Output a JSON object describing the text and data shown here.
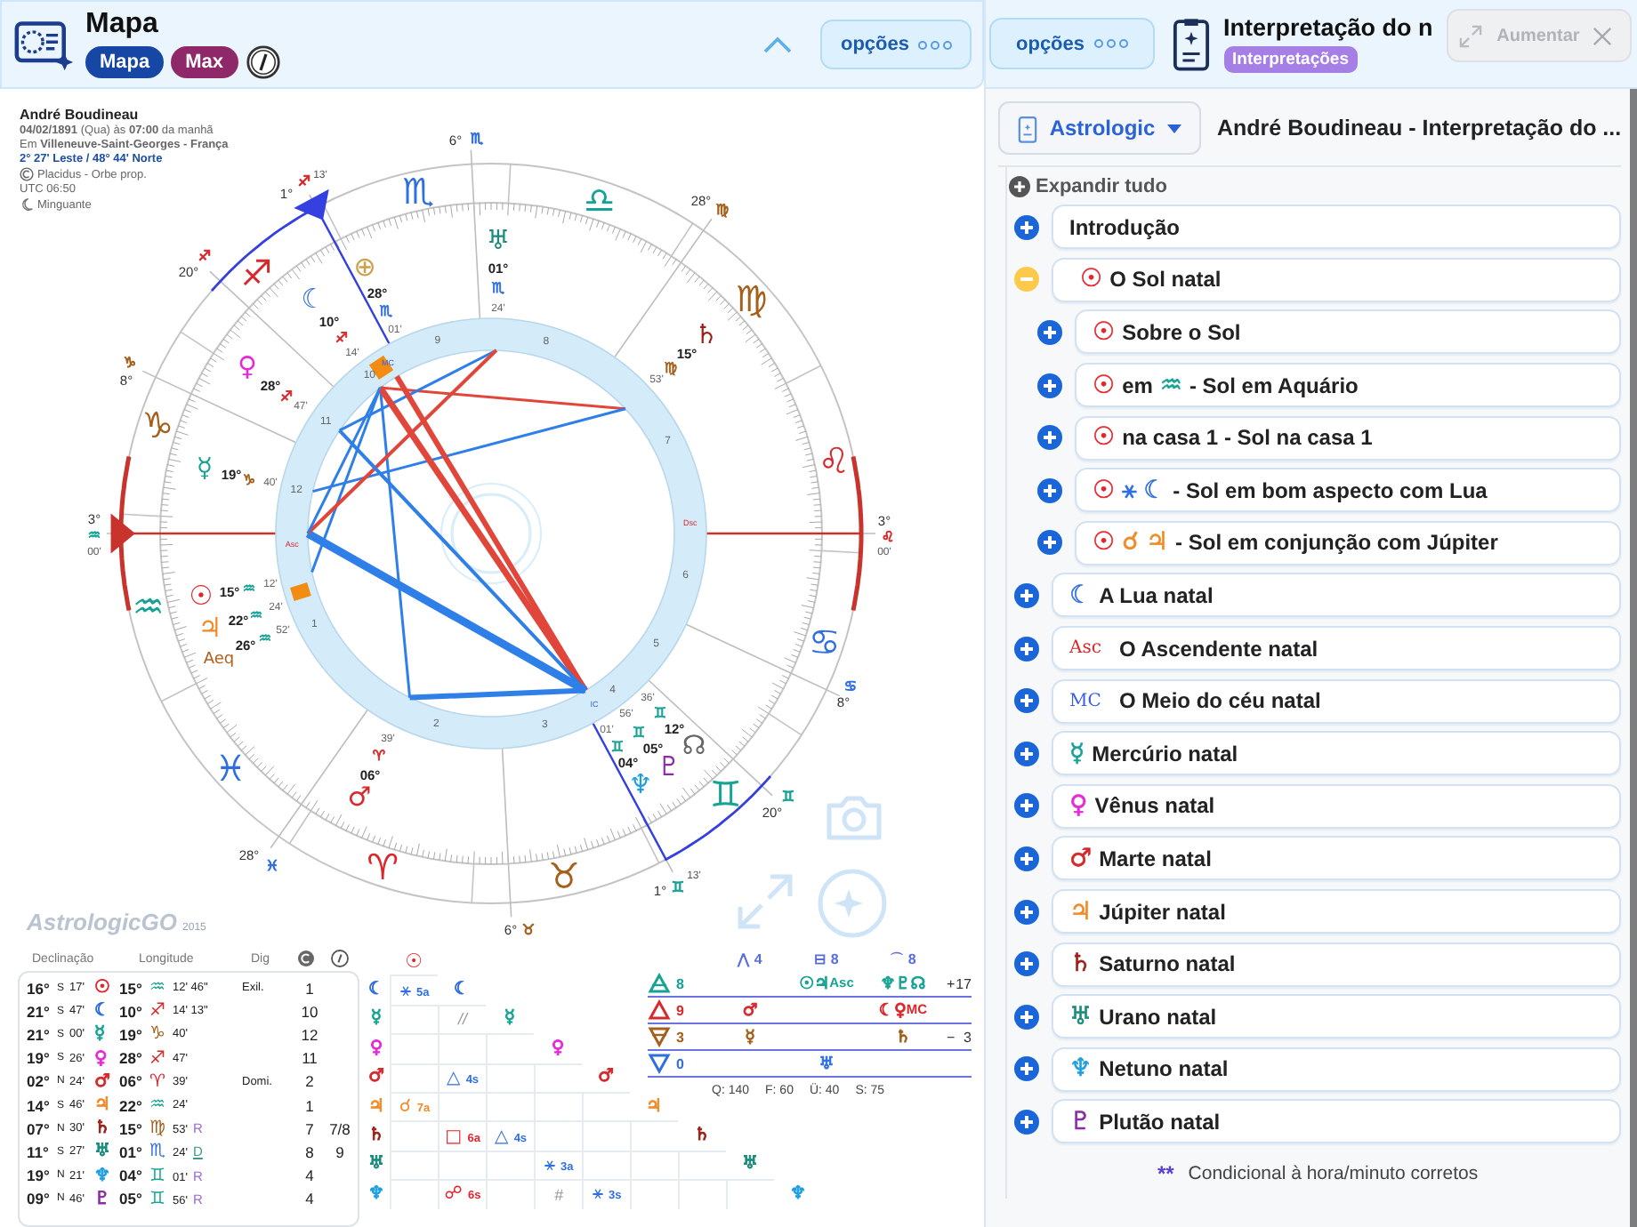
{
  "chart_panel": {
    "title": "Mapa",
    "tags": [
      {
        "label": "Mapa",
        "kind": "chart"
      },
      {
        "label": "Max",
        "kind": "max"
      }
    ],
    "options": "opções"
  },
  "person": {
    "name": "André Boudineau",
    "date_line": "**04/02/1891** (Qua) às **07:00** da manhã",
    "place_line": "Em **Villeneuve-Saint-Georges - França**",
    "coords": "2° 27' Leste / 48° 44' Norte",
    "system": "Placidus - Orbe prop.",
    "utc": "UTC 06:50",
    "phase": "Minguante"
  },
  "wheel": {
    "signs": [
      {
        "g": "♈",
        "color": "#d8282c"
      },
      {
        "g": "♉",
        "color": "#a5601c"
      },
      {
        "g": "♊",
        "color": "#16a394"
      },
      {
        "g": "♋",
        "color": "#2f6fe0"
      },
      {
        "g": "♌",
        "color": "#d8282c"
      },
      {
        "g": "♍",
        "color": "#a5601c"
      },
      {
        "g": "♎",
        "color": "#16a394"
      },
      {
        "g": "♏",
        "color": "#2f6fe0"
      },
      {
        "g": "♐",
        "color": "#d8282c"
      },
      {
        "g": "♑",
        "color": "#a5601c"
      },
      {
        "g": "♒",
        "color": "#16a394"
      },
      {
        "g": "♓",
        "color": "#2f6fe0"
      }
    ],
    "cusps": [
      {
        "deg": "6°",
        "sign": {
          "g": "♏",
          "color": "#2f6fe0"
        }
      },
      {
        "deg": "28°",
        "sign": {
          "g": "♍",
          "color": "#a5601c"
        }
      },
      {
        "deg": "3°",
        "sign": {
          "g": "♌",
          "color": "#d8282c"
        },
        "min": "00'"
      },
      {
        "deg": "8°",
        "sign": {
          "g": "♋",
          "color": "#2f6fe0"
        }
      },
      {
        "deg": "20°",
        "sign": {
          "g": "♊",
          "color": "#16a394"
        }
      },
      {
        "deg": "1°",
        "sign": {
          "g": "♊",
          "color": "#16a394"
        },
        "min": "13'"
      },
      {
        "deg": "6°",
        "sign": {
          "g": "♉",
          "color": "#a5601c"
        }
      },
      {
        "deg": "28°",
        "sign": {
          "g": "♓",
          "color": "#2f6fe0"
        }
      },
      {
        "deg": "3°",
        "sign": {
          "g": "♒",
          "color": "#16a394"
        },
        "min": "00'"
      },
      {
        "deg": "8°",
        "sign": {
          "g": "♑",
          "color": "#a5601c"
        }
      },
      {
        "deg": "20°",
        "sign": {
          "g": "♐",
          "color": "#d8282c"
        }
      },
      {
        "deg": "1°",
        "sign": {
          "g": "♐",
          "color": "#d8282c"
        },
        "min": "13'"
      }
    ],
    "houses": [
      "1",
      "2",
      "3",
      "4",
      "5",
      "6",
      "7",
      "8",
      "9",
      "10",
      "11",
      "12"
    ],
    "angles": [
      "Asc",
      "MC",
      "Dsc",
      "IC"
    ],
    "planets": [
      {
        "g": "☾",
        "color": "#2f6fe0",
        "deg": "10°",
        "sign": {
          "g": "♐",
          "color": "#d8282c"
        },
        "min": "14'"
      },
      {
        "g": "⊕",
        "color": "#c9a24a",
        "deg": "28°",
        "sign": {
          "g": "♏",
          "color": "#2f6fe0"
        },
        "min": "01'"
      },
      {
        "g": "♅",
        "color": "#1b8c7c",
        "deg": "01°",
        "sign": {
          "g": "♏",
          "color": "#2f6fe0"
        },
        "min": "24'"
      },
      {
        "g": "♄",
        "color": "#9a1f17",
        "deg": "15°",
        "sign": {
          "g": "♍",
          "color": "#a5601c"
        },
        "min": "53'"
      },
      {
        "g": "♀",
        "color": "#e62ad6",
        "deg": "28°",
        "sign": {
          "g": "♐",
          "color": "#d8282c"
        },
        "min": "47'"
      },
      {
        "g": "☿",
        "color": "#16a394",
        "deg": "19°",
        "sign": {
          "g": "♑",
          "color": "#a5601c"
        },
        "min": "40'"
      },
      {
        "g": "☉",
        "color": "#e5232b",
        "deg": "15°",
        "sign": {
          "g": "♒",
          "color": "#16a394"
        },
        "min": "12'"
      },
      {
        "g": "♃",
        "color": "#f08c28",
        "deg": "22°",
        "sign": {
          "g": "♒",
          "color": "#16a394"
        },
        "min": "24'"
      },
      {
        "g": "Aeq",
        "color": "#b0601a",
        "deg": "26°",
        "sign": {
          "g": "♒",
          "color": "#16a394"
        },
        "min": "52'"
      },
      {
        "g": "♂",
        "color": "#d8282c",
        "deg": "06°",
        "sign": {
          "g": "♈",
          "color": "#d8282c"
        },
        "min": "39'"
      },
      {
        "g": "♆",
        "color": "#1e9fe0",
        "deg": "04°",
        "sign": {
          "g": "♊",
          "color": "#16a394"
        },
        "min": "01'"
      },
      {
        "g": "♇",
        "color": "#8b2da3",
        "deg": "05°",
        "sign": {
          "g": "♊",
          "color": "#16a394"
        },
        "min": "56'"
      },
      {
        "g": "☊",
        "color": "#666666",
        "deg": "12°",
        "sign": {
          "g": "♊",
          "color": "#16a394"
        },
        "min": "36'"
      }
    ]
  },
  "logo": {
    "name": "AstrologicGO",
    "year": "2015"
  },
  "positions": {
    "headers": [
      "Declinação",
      "Longitude",
      "Dig"
    ],
    "rows": [
      {
        "decl_deg": "16°",
        "decl_dir": "S",
        "decl_min": "17'",
        "planet": {
          "g": "☉",
          "color": "#e5232b"
        },
        "lon_deg": "15°",
        "sign": {
          "g": "♒",
          "color": "#16a394"
        },
        "lon_min": "12' 46\"",
        "dig": "Exil.",
        "house": "1"
      },
      {
        "decl_deg": "21°",
        "decl_dir": "S",
        "decl_min": "47'",
        "planet": {
          "g": "☾",
          "color": "#2f6fe0"
        },
        "lon_deg": "10°",
        "sign": {
          "g": "♐",
          "color": "#d8282c"
        },
        "lon_min": "14' 13\"",
        "house": "10"
      },
      {
        "decl_deg": "21°",
        "decl_dir": "S",
        "decl_min": "00'",
        "planet": {
          "g": "☿",
          "color": "#16a394"
        },
        "lon_deg": "19°",
        "sign": {
          "g": "♑",
          "color": "#a5601c"
        },
        "lon_min": "40'",
        "house": "12"
      },
      {
        "decl_deg": "19°",
        "decl_dir": "S",
        "decl_min": "26'",
        "planet": {
          "g": "♀",
          "color": "#e62ad6"
        },
        "lon_deg": "28°",
        "sign": {
          "g": "♐",
          "color": "#d8282c"
        },
        "lon_min": "47'",
        "house": "11"
      },
      {
        "decl_deg": "02°",
        "decl_dir": "N",
        "decl_min": "24'",
        "planet": {
          "g": "♂",
          "color": "#d8282c"
        },
        "lon_deg": "06°",
        "sign": {
          "g": "♈",
          "color": "#d8282c"
        },
        "lon_min": "39'",
        "dig": "Domi.",
        "house": "2"
      },
      {
        "decl_deg": "14°",
        "decl_dir": "S",
        "decl_min": "46'",
        "planet": {
          "g": "♃",
          "color": "#f08c28"
        },
        "lon_deg": "22°",
        "sign": {
          "g": "♒",
          "color": "#16a394"
        },
        "lon_min": "24'",
        "house": "1"
      },
      {
        "decl_deg": "07°",
        "decl_dir": "N",
        "decl_min": "30'",
        "planet": {
          "g": "♄",
          "color": "#9a1f17"
        },
        "lon_deg": "15°",
        "sign": {
          "g": "♍",
          "color": "#a5601c"
        },
        "lon_min": "53'",
        "motion": "R",
        "house": "7",
        "house2": "7/8"
      },
      {
        "decl_deg": "11°",
        "decl_dir": "S",
        "decl_min": "27'",
        "planet": {
          "g": "♅",
          "color": "#1b8c7c"
        },
        "lon_deg": "01°",
        "sign": {
          "g": "♏",
          "color": "#2f6fe0"
        },
        "lon_min": "24'",
        "motion": "D",
        "house": "8",
        "house2": "9"
      },
      {
        "decl_deg": "19°",
        "decl_dir": "N",
        "decl_min": "21'",
        "planet": {
          "g": "♆",
          "color": "#1e9fe0"
        },
        "lon_deg": "04°",
        "sign": {
          "g": "♊",
          "color": "#16a394"
        },
        "lon_min": "01'",
        "motion": "R",
        "house": "4"
      },
      {
        "decl_deg": "09°",
        "decl_dir": "N",
        "decl_min": "46'",
        "planet": {
          "g": "♇",
          "color": "#8b2da3"
        },
        "lon_deg": "05°",
        "sign": {
          "g": "♊",
          "color": "#16a394"
        },
        "lon_min": "56'",
        "motion": "R",
        "house": "4"
      }
    ]
  },
  "aspect_grid": {
    "top": {
      "g": "☉",
      "color": "#e5232b"
    },
    "rows": [
      {
        "label": {
          "g": "☾",
          "color": "#2f6fe0"
        },
        "cells": [
          {
            "kind": "aspect",
            "g": "⚹",
            "orb": "5a",
            "color": "#2f6fe0"
          }
        ],
        "diag": {
          "g": "☾",
          "color": "#2f6fe0"
        }
      },
      {
        "label": {
          "g": "☿",
          "color": "#16a394"
        },
        "cells": [
          {
            "kind": "empty"
          },
          {
            "kind": "mark",
            "text": "//"
          }
        ],
        "diag": {
          "g": "☿",
          "color": "#16a394"
        }
      },
      {
        "label": {
          "g": "♀",
          "color": "#e62ad6"
        },
        "cells": [
          {
            "kind": "empty"
          },
          {
            "kind": "empty"
          },
          {
            "kind": "empty"
          }
        ],
        "diag": {
          "g": "♀",
          "color": "#e62ad6"
        }
      },
      {
        "label": {
          "g": "♂",
          "color": "#d8282c"
        },
        "cells": [
          {
            "kind": "empty"
          },
          {
            "kind": "aspect",
            "g": "△",
            "orb": "4s",
            "color": "#2f6fe0"
          },
          {
            "kind": "empty"
          },
          {
            "kind": "empty"
          }
        ],
        "diag": {
          "g": "♂",
          "color": "#d8282c"
        }
      },
      {
        "label": {
          "g": "♃",
          "color": "#f08c28"
        },
        "cells": [
          {
            "kind": "aspect",
            "g": "☌",
            "orb": "7a",
            "color": "#f08c28"
          },
          {
            "kind": "empty"
          },
          {
            "kind": "empty"
          },
          {
            "kind": "empty"
          },
          {
            "kind": "empty"
          }
        ],
        "diag": {
          "g": "♃",
          "color": "#f08c28"
        }
      },
      {
        "label": {
          "g": "♄",
          "color": "#9a1f17"
        },
        "cells": [
          {
            "kind": "empty"
          },
          {
            "kind": "aspect",
            "g": "□",
            "orb": "6a",
            "color": "#e5232b"
          },
          {
            "kind": "aspect",
            "g": "△",
            "orb": "4s",
            "color": "#2f6fe0"
          },
          {
            "kind": "empty"
          },
          {
            "kind": "empty"
          },
          {
            "kind": "empty"
          }
        ],
        "diag": {
          "g": "♄",
          "color": "#9a1f17"
        }
      },
      {
        "label": {
          "g": "♅",
          "color": "#1b8c7c"
        },
        "cells": [
          {
            "kind": "empty"
          },
          {
            "kind": "empty"
          },
          {
            "kind": "empty"
          },
          {
            "kind": "aspect",
            "g": "⚹",
            "orb": "3a",
            "color": "#2f6fe0"
          },
          {
            "kind": "empty"
          },
          {
            "kind": "empty"
          },
          {
            "kind": "empty"
          }
        ],
        "diag": {
          "g": "♅",
          "color": "#1b8c7c"
        }
      },
      {
        "label": {
          "g": "♆",
          "color": "#1e9fe0"
        },
        "cells": [
          {
            "kind": "empty"
          },
          {
            "kind": "aspect",
            "g": "☍",
            "orb": "6s",
            "color": "#e5232b"
          },
          {
            "kind": "empty"
          },
          {
            "kind": "mark",
            "text": "#"
          },
          {
            "kind": "aspect",
            "g": "⚹",
            "orb": "3s",
            "color": "#2f6fe0"
          },
          {
            "kind": "empty"
          },
          {
            "kind": "empty"
          },
          {
            "kind": "empty"
          }
        ],
        "diag": {
          "g": "♆",
          "color": "#1e9fe0"
        }
      }
    ]
  },
  "elements": {
    "headers": [
      {
        "g": "⋀",
        "value": "4"
      },
      {
        "g": "⊟",
        "value": "8"
      },
      {
        "g": "⌒",
        "value": "8"
      }
    ],
    "rows": [
      {
        "kind": "air",
        "count": "8",
        "cells": [
          [],
          [
            {
              "g": "☉",
              "color": "#16a394"
            },
            {
              "g": "♃",
              "color": "#16a394"
            },
            {
              "g": "Asc",
              "color": "#16a394"
            }
          ],
          [
            {
              "g": "♆",
              "color": "#16a394"
            },
            {
              "g": "♇",
              "color": "#16a394"
            },
            {
              "g": "☊",
              "color": "#16a394"
            }
          ]
        ]
      },
      {
        "kind": "fire",
        "count": "9",
        "cells": [
          [
            {
              "g": "♂",
              "color": "#d8282c"
            }
          ],
          [],
          [
            {
              "g": "☾",
              "color": "#d8282c"
            },
            {
              "g": "♀",
              "color": "#d8282c"
            },
            {
              "g": "MC",
              "color": "#d8282c"
            }
          ]
        ]
      },
      {
        "kind": "earth",
        "count": "3",
        "cells": [
          [
            {
              "g": "☿",
              "color": "#a5601c"
            }
          ],
          [],
          [
            {
              "g": "♄",
              "color": "#a5601c"
            }
          ]
        ]
      },
      {
        "kind": "water",
        "count": "0",
        "cells": [
          [],
          [
            {
              "g": "♅",
              "color": "#2f6fe0"
            }
          ],
          []
        ]
      }
    ],
    "polarity": [
      {
        "sign": "+",
        "value": "17"
      },
      {
        "sign": "−",
        "value": "3"
      }
    ],
    "totals": [
      "Q: 140",
      "F: 60",
      "Ü: 40",
      "S: 75"
    ]
  },
  "interpretation": {
    "options": "opções",
    "title": "Interpretação do n",
    "badge": "Interpretações",
    "enlarge": "Aumentar",
    "source": "Astrologic",
    "heading": "André Boudineau - Interpretação do ...",
    "expand_all": "Expandir tudo",
    "items": [
      {
        "expanded": false,
        "parts": [
          {
            "kind": "text",
            "text": "Introdução"
          }
        ]
      },
      {
        "expanded": true,
        "parts": [
          {
            "kind": "glyph",
            "text": "☉",
            "color": "#e5232b"
          },
          {
            "kind": "text",
            "text": "O Sol natal"
          }
        ],
        "children": [
          {
            "expanded": false,
            "parts": [
              {
                "kind": "glyph",
                "text": "☉",
                "color": "#e5232b"
              },
              {
                "kind": "text",
                "text": "Sobre o Sol"
              }
            ]
          },
          {
            "expanded": false,
            "parts": [
              {
                "kind": "glyph",
                "text": "☉",
                "color": "#e5232b"
              },
              {
                "kind": "text",
                "text": "em"
              },
              {
                "kind": "glyph",
                "text": "♒",
                "color": "#16a394"
              },
              {
                "kind": "text",
                "text": "- Sol em Aquário"
              }
            ]
          },
          {
            "expanded": false,
            "parts": [
              {
                "kind": "glyph",
                "text": "☉",
                "color": "#e5232b"
              },
              {
                "kind": "text",
                "text": "na casa 1 - Sol na casa 1"
              }
            ]
          },
          {
            "expanded": false,
            "parts": [
              {
                "kind": "glyph",
                "text": "☉",
                "color": "#e5232b"
              },
              {
                "kind": "glyph",
                "text": "⚹",
                "color": "#2f6fe0"
              },
              {
                "kind": "glyph",
                "text": "☾",
                "color": "#2f6fe0"
              },
              {
                "kind": "text",
                "text": "- Sol em bom aspecto com Lua"
              }
            ]
          },
          {
            "expanded": false,
            "parts": [
              {
                "kind": "glyph",
                "text": "☉",
                "color": "#e5232b"
              },
              {
                "kind": "glyph",
                "text": "☌",
                "color": "#f08c28"
              },
              {
                "kind": "glyph",
                "text": "♃",
                "color": "#f08c28"
              },
              {
                "kind": "text",
                "text": "- Sol em conjunção com Júpiter"
              }
            ]
          }
        ]
      },
      {
        "expanded": false,
        "parts": [
          {
            "kind": "glyph",
            "text": "☾",
            "color": "#2f6fe0"
          },
          {
            "kind": "text",
            "text": "A Lua natal"
          }
        ]
      },
      {
        "expanded": false,
        "parts": [
          {
            "kind": "abbr",
            "text": "Asc",
            "color": "#d8282c"
          },
          {
            "kind": "text",
            "text": "O Ascendente natal"
          }
        ]
      },
      {
        "expanded": false,
        "parts": [
          {
            "kind": "abbr",
            "text": "MC",
            "color": "#3a5fe0"
          },
          {
            "kind": "text",
            "text": "O Meio do céu natal"
          }
        ]
      },
      {
        "expanded": false,
        "parts": [
          {
            "kind": "glyph",
            "text": "☿",
            "color": "#16a394"
          },
          {
            "kind": "text",
            "text": "Mercúrio natal"
          }
        ]
      },
      {
        "expanded": false,
        "parts": [
          {
            "kind": "glyph",
            "text": "♀",
            "color": "#e62ad6"
          },
          {
            "kind": "text",
            "text": "Vênus natal"
          }
        ]
      },
      {
        "expanded": false,
        "parts": [
          {
            "kind": "glyph",
            "text": "♂",
            "color": "#d8282c"
          },
          {
            "kind": "text",
            "text": "Marte natal"
          }
        ]
      },
      {
        "expanded": false,
        "parts": [
          {
            "kind": "glyph",
            "text": "♃",
            "color": "#f08c28"
          },
          {
            "kind": "text",
            "text": "Júpiter natal"
          }
        ]
      },
      {
        "expanded": false,
        "parts": [
          {
            "kind": "glyph",
            "text": "♄",
            "color": "#9a1f17"
          },
          {
            "kind": "text",
            "text": "Saturno natal"
          }
        ]
      },
      {
        "expanded": false,
        "parts": [
          {
            "kind": "glyph",
            "text": "♅",
            "color": "#1b8c7c"
          },
          {
            "kind": "text",
            "text": "Urano natal"
          }
        ]
      },
      {
        "expanded": false,
        "parts": [
          {
            "kind": "glyph",
            "text": "♆",
            "color": "#1e9fe0"
          },
          {
            "kind": "text",
            "text": "Netuno natal"
          }
        ]
      },
      {
        "expanded": false,
        "parts": [
          {
            "kind": "glyph",
            "text": "♇",
            "color": "#8b2da3"
          },
          {
            "kind": "text",
            "text": "Plutão natal"
          }
        ]
      }
    ],
    "footnote": {
      "mark": "**",
      "text": "Condicional à hora/minuto corretos"
    }
  }
}
